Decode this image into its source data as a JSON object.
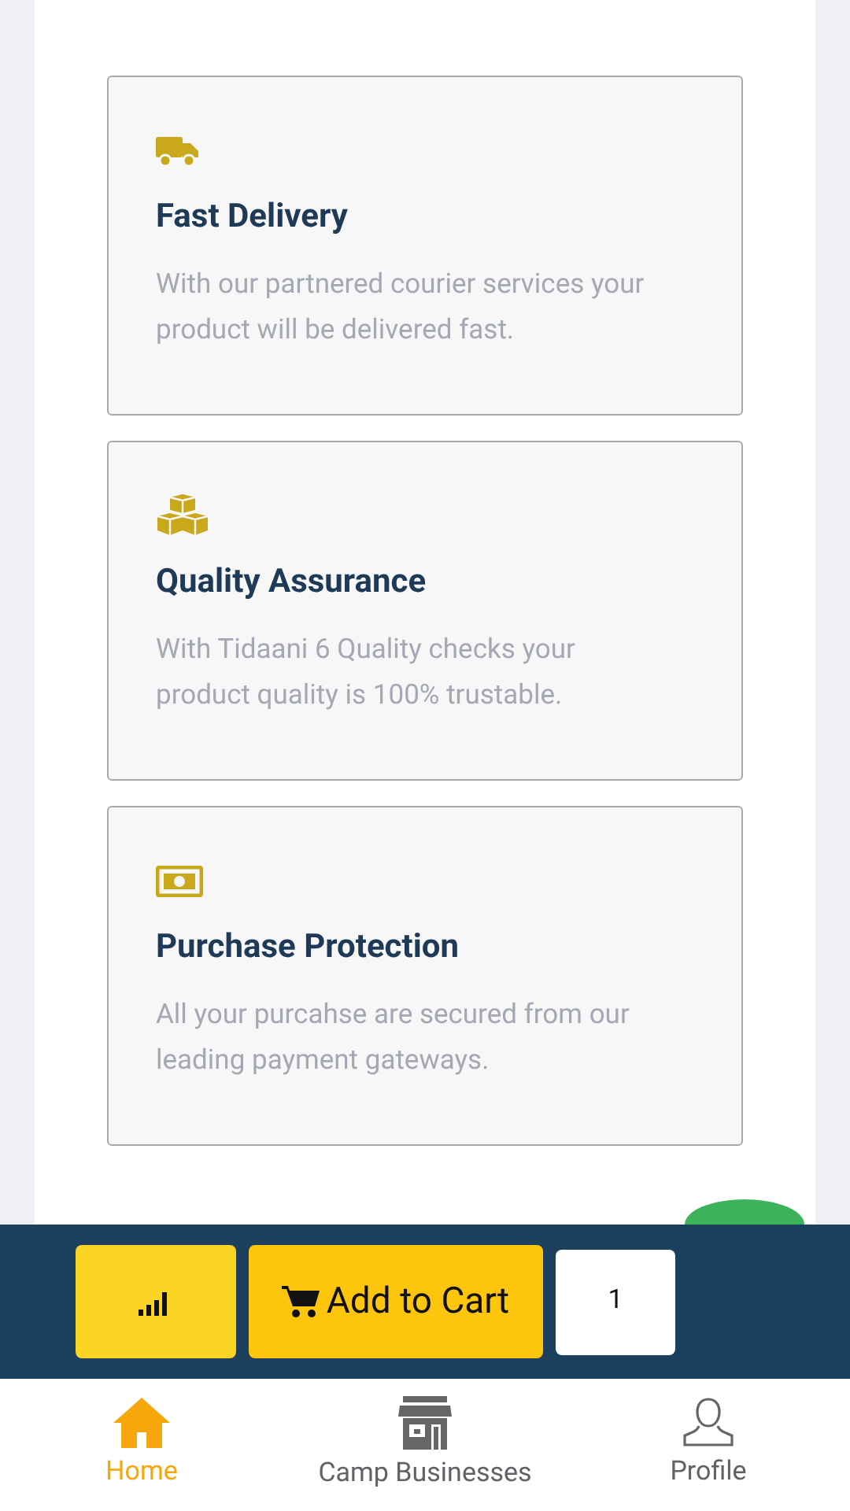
{
  "features": [
    {
      "kind": "truck",
      "title": "Fast Delivery",
      "text": "With our partnered courier services your product will be delivered fast."
    },
    {
      "kind": "boxes",
      "title": "Quality Assurance",
      "text": "With Tidaani 6 Quality checks your product quality is 100% trustable."
    },
    {
      "kind": "money",
      "title": "Purchase Protection",
      "text": "All your purcahse are secured from our leading payment gateways."
    }
  ],
  "cart_bar": {
    "add_label": "Add to Cart",
    "quantity": "1"
  },
  "nav": [
    {
      "kind": "home",
      "label": "Home",
      "selected": true
    },
    {
      "kind": "store",
      "label": "Camp Businesses",
      "selected": false
    },
    {
      "kind": "profile",
      "label": "Profile",
      "selected": false
    }
  ]
}
